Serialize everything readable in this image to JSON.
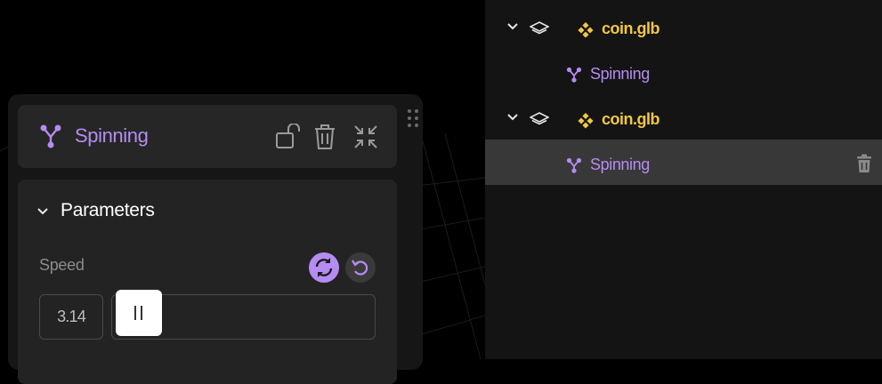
{
  "outliner": {
    "items": [
      {
        "type": "file",
        "label": "coin.glb"
      },
      {
        "type": "animation",
        "label": "Spinning"
      },
      {
        "type": "file",
        "label": "coin.glb"
      },
      {
        "type": "animation",
        "label": "Spinning",
        "selected": true
      }
    ]
  },
  "panel": {
    "title": "Spinning",
    "section_title": "Parameters",
    "param_label": "Speed",
    "value": "3.14",
    "slider_fraction": 0.02
  },
  "colors": {
    "accent": "#b58cf2",
    "file": "#f2c744",
    "selected_row": "#383838"
  }
}
